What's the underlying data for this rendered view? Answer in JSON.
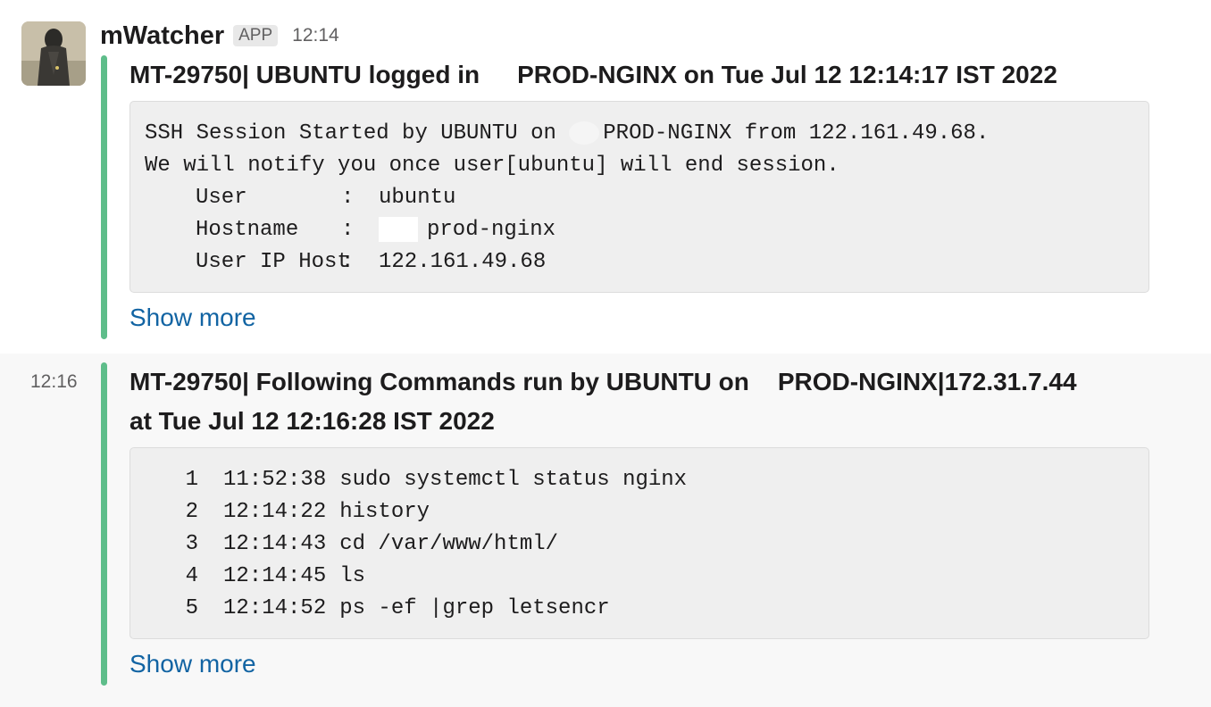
{
  "message_1": {
    "sender": "mWatcher",
    "badge": "APP",
    "time": "12:14",
    "title_part1": "MT-29750| UBUNTU logged in",
    "title_part2": "PROD-NGINX on Tue Jul 12 12:14:17 IST 2022",
    "lines": [
      "SSH Session Started by UBUNTU on",
      "PROD-NGINX from 122.161.49.68.",
      "We will notify you once user[ubuntu] will end session."
    ],
    "fields": [
      {
        "key": "User",
        "sep": ":",
        "value": "ubuntu"
      },
      {
        "key": "Hostname",
        "sep": ":",
        "value": "prod-nginx"
      },
      {
        "key": "User IP Host",
        "sep": ":",
        "value": "122.161.49.68"
      }
    ],
    "show_more": "Show more"
  },
  "message_2": {
    "time": "12:16",
    "title_line1_a": "MT-29750| Following Commands run by UBUNTU on",
    "title_line1_b": "PROD-NGINX|172.31.7.44",
    "title_line2": "at Tue Jul 12 12:16:28 IST 2022",
    "commands": [
      {
        "num": "1",
        "time": "11:52:38",
        "cmd": "sudo systemctl status nginx"
      },
      {
        "num": "2",
        "time": "12:14:22",
        "cmd": "history"
      },
      {
        "num": "3",
        "time": "12:14:43",
        "cmd": "cd /var/www/html/"
      },
      {
        "num": "4",
        "time": "12:14:45",
        "cmd": "ls"
      },
      {
        "num": "5",
        "time": "12:14:52",
        "cmd": "ps -ef |grep letsencr"
      }
    ],
    "show_more": "Show more"
  },
  "colors": {
    "accent_bar": "#5ebd8a",
    "link": "#1264a3"
  }
}
